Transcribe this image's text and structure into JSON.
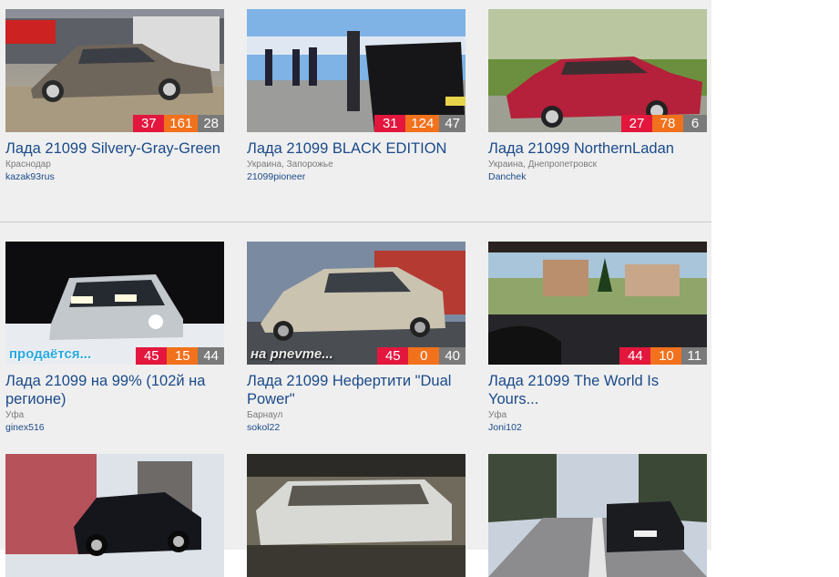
{
  "cards": [
    {
      "title": "Лада 21099 Silvery-Gray-Green",
      "location": "Краснодар",
      "user": "kazak93rus",
      "stats": [
        "37",
        "161",
        "28"
      ],
      "overlay": ""
    },
    {
      "title": "Лада 21099 BLACK EDITION",
      "location": "Украина, Запорожье",
      "user": "21099pioneer",
      "stats": [
        "31",
        "124",
        "47"
      ],
      "overlay": ""
    },
    {
      "title": "Лада 21099 NorthernLadan",
      "location": "Украина, Днепропетровск",
      "user": "Danchek",
      "stats": [
        "27",
        "78",
        "6"
      ],
      "overlay": ""
    },
    {
      "title": "Лада 21099 на 99% (102й на регионе)",
      "location": "Уфа",
      "user": "ginex516",
      "stats": [
        "45",
        "15",
        "44"
      ],
      "overlay": "продаётся..."
    },
    {
      "title": "Лада 21099 Нефертити \"Dual Power\"",
      "location": "Барнаул",
      "user": "sokol22",
      "stats": [
        "45",
        "0",
        "40"
      ],
      "overlay": "на pnevme..."
    },
    {
      "title": "Лада 21099 The World Is Yours...",
      "location": "Уфа",
      "user": "Joni102",
      "stats": [
        "44",
        "10",
        "11"
      ],
      "overlay": ""
    },
    {
      "title": "",
      "location": "",
      "user": "",
      "stats": [],
      "overlay": ""
    },
    {
      "title": "",
      "location": "",
      "user": "",
      "stats": [],
      "overlay": ""
    },
    {
      "title": "",
      "location": "",
      "user": "",
      "stats": [],
      "overlay": ""
    }
  ],
  "colors": {
    "views": "#e3173e",
    "likes": "#f2711c",
    "comments": "#7a7a7a",
    "link": "#1a4a8a"
  }
}
